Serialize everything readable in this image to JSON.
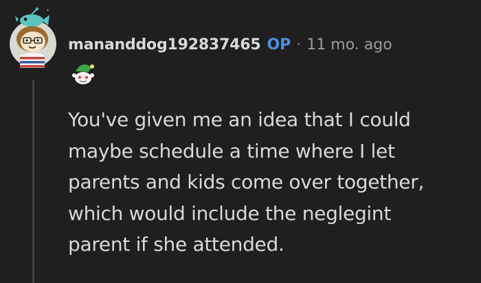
{
  "comment": {
    "author": "mananddog192837465",
    "op_badge": "OP",
    "separator": "·",
    "timestamp": "11 mo. ago",
    "avatar_icon": "snoo-avatar-with-fish-hat-icon",
    "flair_icon": "snoo-elf-hat-flair-icon",
    "body_lines": [
      "You've given me an idea that I could",
      "maybe schedule a time where I let",
      "parents and kids come over together,",
      "which would include the neglegint",
      "parent if she attended."
    ]
  },
  "colors": {
    "background": "#1f1f1f",
    "text": "#d7dadc",
    "op_accent": "#4a90e2",
    "meta": "#9a9c9e",
    "thread_line": "#3f3f3f"
  }
}
